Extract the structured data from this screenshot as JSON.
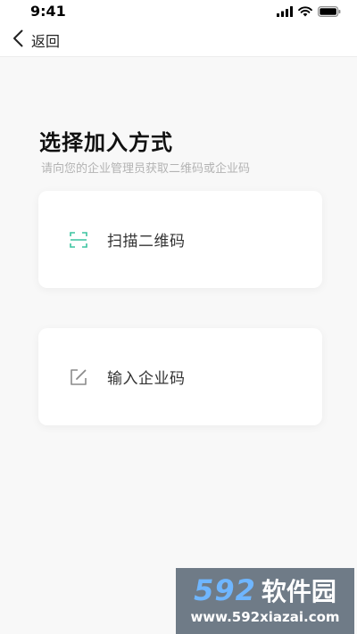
{
  "status_bar": {
    "time": "9:41"
  },
  "nav": {
    "back_label": "返回"
  },
  "page": {
    "title": "选择加入方式",
    "subtitle": "请向您的企业管理员获取二维码或企业码"
  },
  "options": [
    {
      "label": "扫描二维码",
      "icon": "scan-qr-icon"
    },
    {
      "label": "输入企业码",
      "icon": "edit-icon"
    }
  ],
  "watermark": {
    "brand_number": "592",
    "brand_text": "软件园",
    "url": "www.592xiazai.com"
  },
  "colors": {
    "accent_green": "#3cc4a0",
    "icon_gray": "#8a8a8a",
    "watermark_blue": "#6fb6ff"
  }
}
